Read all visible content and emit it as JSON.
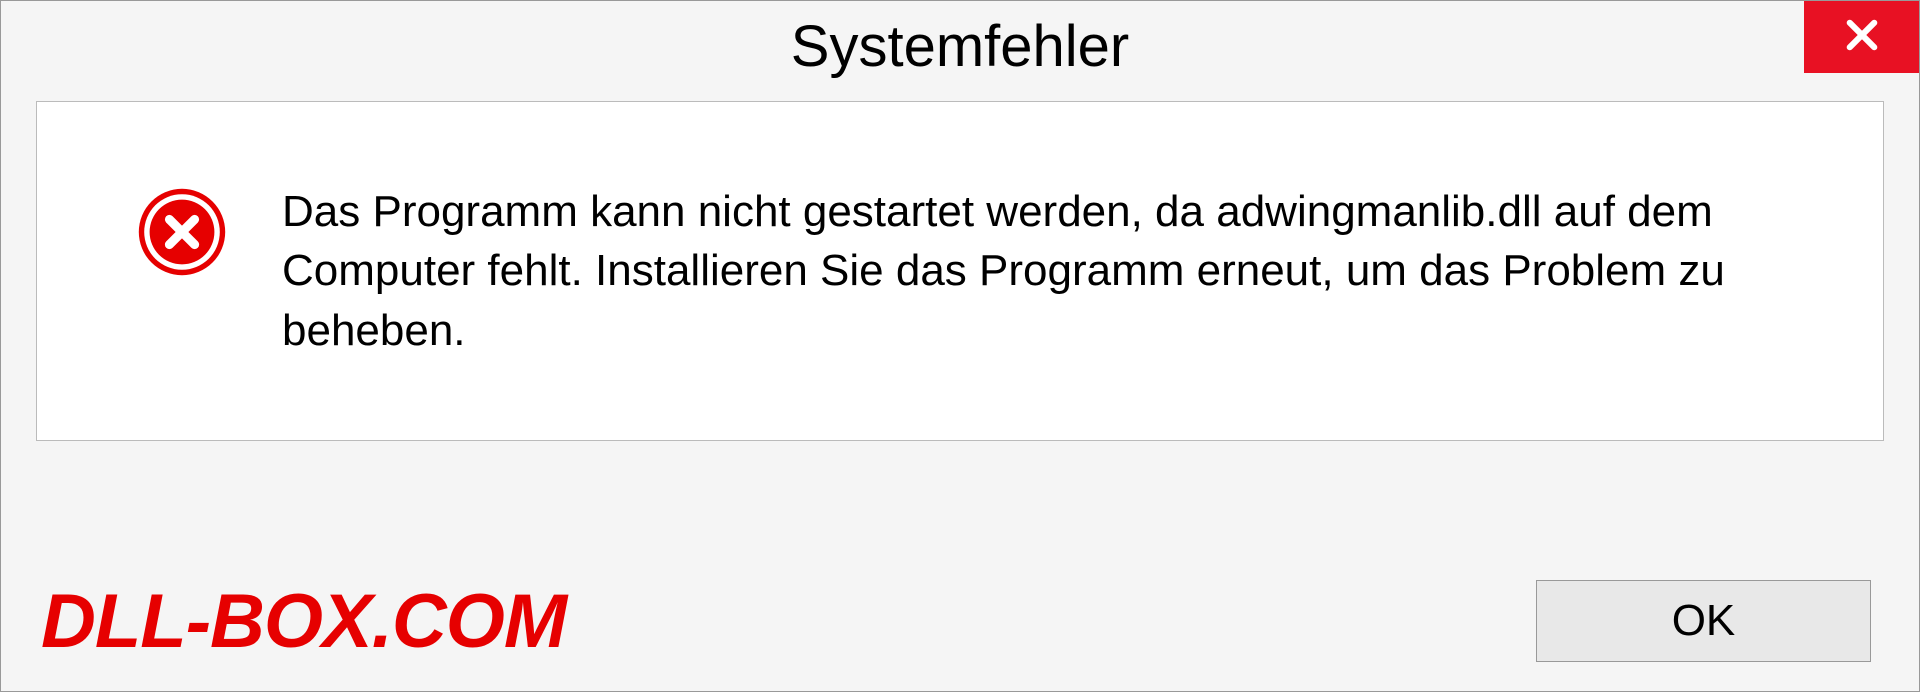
{
  "dialog": {
    "title": "Systemfehler",
    "message": "Das Programm kann nicht gestartet werden, da adwingmanlib.dll auf dem Computer fehlt. Installieren Sie das Programm erneut, um das Problem zu beheben.",
    "ok_label": "OK"
  },
  "watermark": "DLL-BOX.COM"
}
